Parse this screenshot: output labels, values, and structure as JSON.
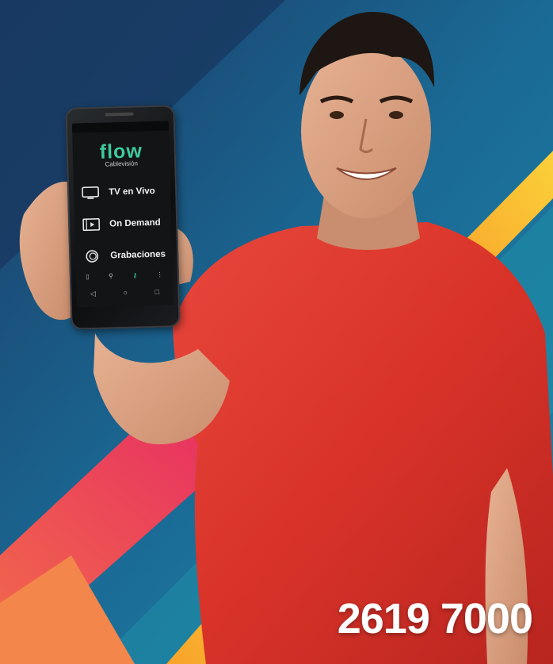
{
  "phone_app": {
    "logo": "flow",
    "subtitle": "Cablevisión",
    "menu": [
      {
        "label": "TV en Vivo",
        "icon": "tv-icon"
      },
      {
        "label": "On Demand",
        "icon": "play-icon"
      },
      {
        "label": "Grabaciones",
        "icon": "record-icon"
      }
    ],
    "nav_icons": [
      "home-icon",
      "search-icon",
      "key-icon",
      "more-icon"
    ],
    "system_icons": [
      "back-icon",
      "home-circle-icon",
      "recent-apps-icon"
    ]
  },
  "promo": {
    "phone_number": "2619 7000"
  },
  "colors": {
    "brand_green": "#3ecb9c",
    "background_blue": "#1e6f9a",
    "shirt_red": "#e0342c",
    "stripe_yellow": "#f7c633",
    "stripe_pink": "#e83a6b"
  }
}
